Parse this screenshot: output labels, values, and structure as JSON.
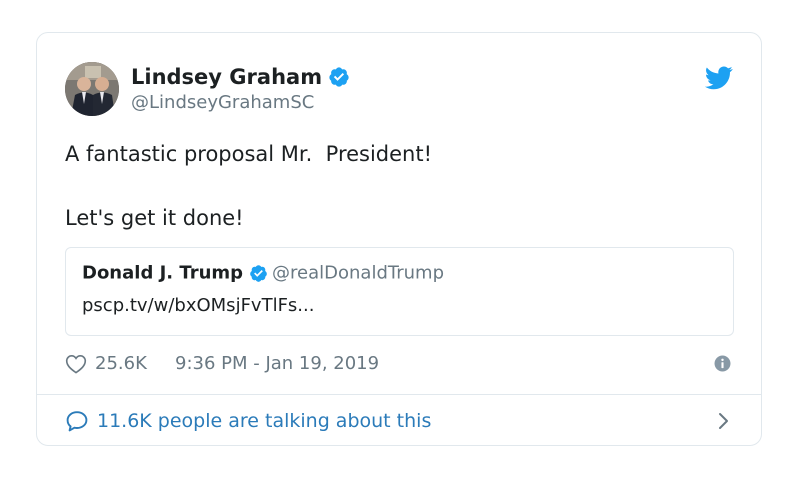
{
  "author": {
    "display_name": "Lindsey Graham",
    "handle": "@LindseyGrahamSC"
  },
  "tweet": {
    "line1": "A fantastic proposal Mr.  President!",
    "line2": "Let's get it done!"
  },
  "quoted": {
    "display_name": "Donald J. Trump",
    "handle": "@realDonaldTrump",
    "text": "pscp.tv/w/bxOMsjFvTlFs..."
  },
  "meta": {
    "likes": "25.6K",
    "timestamp": "9:36 PM - Jan 19, 2019"
  },
  "footer": {
    "conversation": "11.6K people are talking about this"
  },
  "colors": {
    "twitter_blue": "#1da1f2",
    "link_blue": "#2b7bb9",
    "secondary_text": "#697882",
    "border": "#e1e8ed"
  },
  "icons": {
    "verified": "verified-badge-icon",
    "brand": "twitter-bird-icon",
    "like": "heart-icon",
    "info": "info-icon",
    "reply": "chat-bubble-icon",
    "chevron": "chevron-right-icon"
  }
}
